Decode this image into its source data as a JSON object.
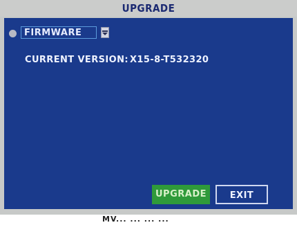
{
  "window": {
    "title": "UPGRADE"
  },
  "upgrade_form": {
    "source": {
      "selected": "FIRMWARE",
      "radio_selected": true
    },
    "current_version": {
      "label": "CURRENT VERSION:",
      "value": "X15-8-T532320"
    }
  },
  "buttons": {
    "upgrade_label": "UPGRADE",
    "exit_label": "EXIT"
  },
  "watermark_text": "MV...  ...  ...  ...",
  "colors": {
    "panel": "#1a3a8c",
    "titlebar": "#cbcccb",
    "upgrade_button": "#2f9a3a",
    "text": "#eef2ff"
  },
  "icons": {
    "radio": "radio-dot-icon",
    "dropdown": "chevron-down-icon"
  }
}
